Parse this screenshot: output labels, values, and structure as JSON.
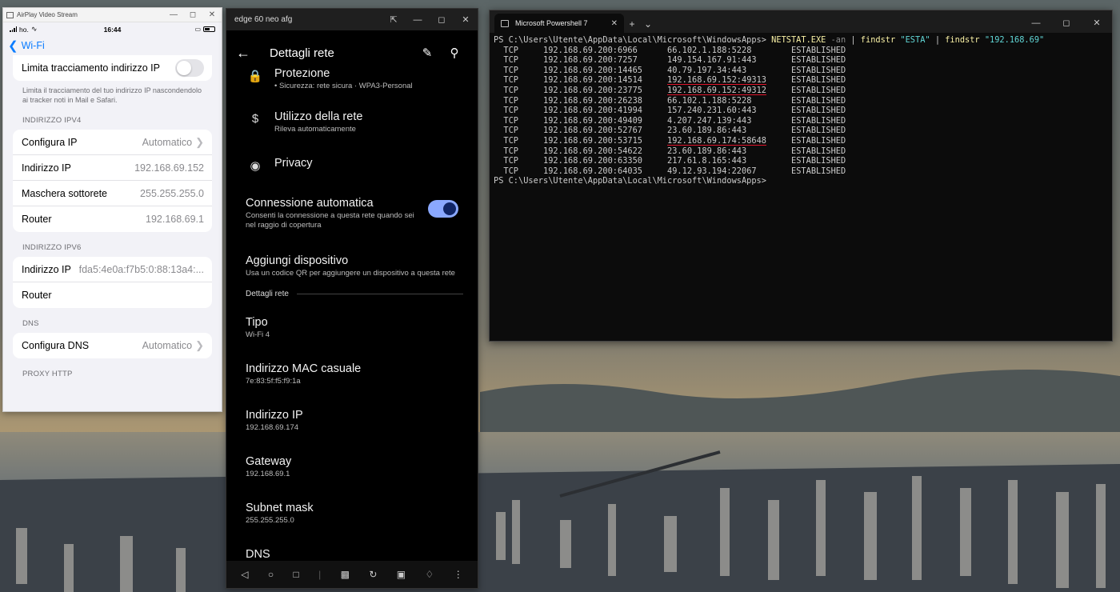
{
  "ios_window": {
    "title": "AirPlay Video Stream",
    "status": {
      "carrier": "ho.",
      "time": "16:44"
    },
    "back_label": "Wi-Fi",
    "limit_tracking": {
      "label": "Limita tracciamento indirizzo IP",
      "enabled": false,
      "footer": "Limita il tracciamento del tuo indirizzo IP nascondendolo ai tracker noti in Mail e Safari."
    },
    "ipv4": {
      "header": "INDIRIZZO IPV4",
      "rows": [
        {
          "label": "Configura IP",
          "value": "Automatico"
        },
        {
          "label": "Indirizzo IP",
          "value": "192.168.69.152"
        },
        {
          "label": "Maschera sottorete",
          "value": "255.255.255.0"
        },
        {
          "label": "Router",
          "value": "192.168.69.1"
        }
      ]
    },
    "ipv6": {
      "header": "INDIRIZZO IPV6",
      "rows": [
        {
          "label": "Indirizzo IP",
          "value": "fda5:4e0a:f7b5:0:88:13a4:..."
        },
        {
          "label": "Router",
          "value": ""
        }
      ]
    },
    "dns": {
      "header": "DNS",
      "rows": [
        {
          "label": "Configura DNS",
          "value": "Automatico"
        }
      ]
    },
    "proxy_header": "PROXY HTTP"
  },
  "android_window": {
    "title": "edge 60 neo afg",
    "appbar_title": "Dettagli rete",
    "items": [
      {
        "icon": "lock-icon",
        "title": "Protezione",
        "subtitle": "• Sicurezza: rete sicura · WPA3-Personal"
      },
      {
        "icon": "dollar-icon",
        "title": "Utilizzo della rete",
        "subtitle": "Rileva automaticamente"
      },
      {
        "icon": "privacy-eye-icon",
        "title": "Privacy",
        "subtitle": ""
      }
    ],
    "auto_connect": {
      "title": "Connessione automatica",
      "subtitle": "Consenti la connessione a questa rete quando sei nel raggio di copertura",
      "enabled": true
    },
    "add_device": {
      "title": "Aggiungi dispositivo",
      "subtitle": "Usa un codice QR per aggiungere un dispositivo a questa rete"
    },
    "section_title": "Dettagli rete",
    "details": [
      {
        "title": "Tipo",
        "value": "Wi-Fi 4"
      },
      {
        "title": "Indirizzo MAC casuale",
        "value": "7e:83:5f:f5:f9:1a"
      },
      {
        "title": "Indirizzo IP",
        "value": "192.168.69.174"
      },
      {
        "title": "Gateway",
        "value": "192.168.69.1"
      },
      {
        "title": "Subnet mask",
        "value": "255.255.255.0"
      },
      {
        "title": "DNS",
        "value": ""
      }
    ]
  },
  "powershell_window": {
    "tab_title": "Microsoft Powershell 7",
    "prompt": "PS C:\\Users\\Utente\\AppData\\Local\\Microsoft\\WindowsApps>",
    "command": {
      "exe": "NETSTAT.EXE",
      "arg": "-an",
      "pipe": "|",
      "find1": "findstr",
      "pattern1": "\"ESTA\"",
      "find2": "findstr",
      "pattern2": "\"192.168.69\""
    },
    "rows": [
      {
        "proto": "TCP",
        "local": "192.168.69.200:6966",
        "foreign": "66.102.1.188:5228",
        "state": "ESTABLISHED",
        "highlight": false
      },
      {
        "proto": "TCP",
        "local": "192.168.69.200:7257",
        "foreign": "149.154.167.91:443",
        "state": "ESTABLISHED",
        "highlight": false
      },
      {
        "proto": "TCP",
        "local": "192.168.69.200:14465",
        "foreign": "40.79.197.34:443",
        "state": "ESTABLISHED",
        "highlight": false
      },
      {
        "proto": "TCP",
        "local": "192.168.69.200:14514",
        "foreign": "192.168.69.152:49313",
        "state": "ESTABLISHED",
        "highlight": true
      },
      {
        "proto": "TCP",
        "local": "192.168.69.200:23775",
        "foreign": "192.168.69.152:49312",
        "state": "ESTABLISHED",
        "highlight": true
      },
      {
        "proto": "TCP",
        "local": "192.168.69.200:26238",
        "foreign": "66.102.1.188:5228",
        "state": "ESTABLISHED",
        "highlight": false
      },
      {
        "proto": "TCP",
        "local": "192.168.69.200:41994",
        "foreign": "157.240.231.60:443",
        "state": "ESTABLISHED",
        "highlight": false
      },
      {
        "proto": "TCP",
        "local": "192.168.69.200:49409",
        "foreign": "4.207.247.139:443",
        "state": "ESTABLISHED",
        "highlight": false
      },
      {
        "proto": "TCP",
        "local": "192.168.69.200:52767",
        "foreign": "23.60.189.86:443",
        "state": "ESTABLISHED",
        "highlight": false
      },
      {
        "proto": "TCP",
        "local": "192.168.69.200:53715",
        "foreign": "192.168.69.174:58648",
        "state": "ESTABLISHED",
        "highlight": true
      },
      {
        "proto": "TCP",
        "local": "192.168.69.200:54622",
        "foreign": "23.60.189.86:443",
        "state": "ESTABLISHED",
        "highlight": false
      },
      {
        "proto": "TCP",
        "local": "192.168.69.200:63350",
        "foreign": "217.61.8.165:443",
        "state": "ESTABLISHED",
        "highlight": false
      },
      {
        "proto": "TCP",
        "local": "192.168.69.200:64035",
        "foreign": "49.12.93.194:22067",
        "state": "ESTABLISHED",
        "highlight": false
      }
    ]
  },
  "colors": {
    "ios_accent": "#0a7cff",
    "android_toggle": "#8aa8ff",
    "ps_highlight_underline": "#e0142b"
  }
}
